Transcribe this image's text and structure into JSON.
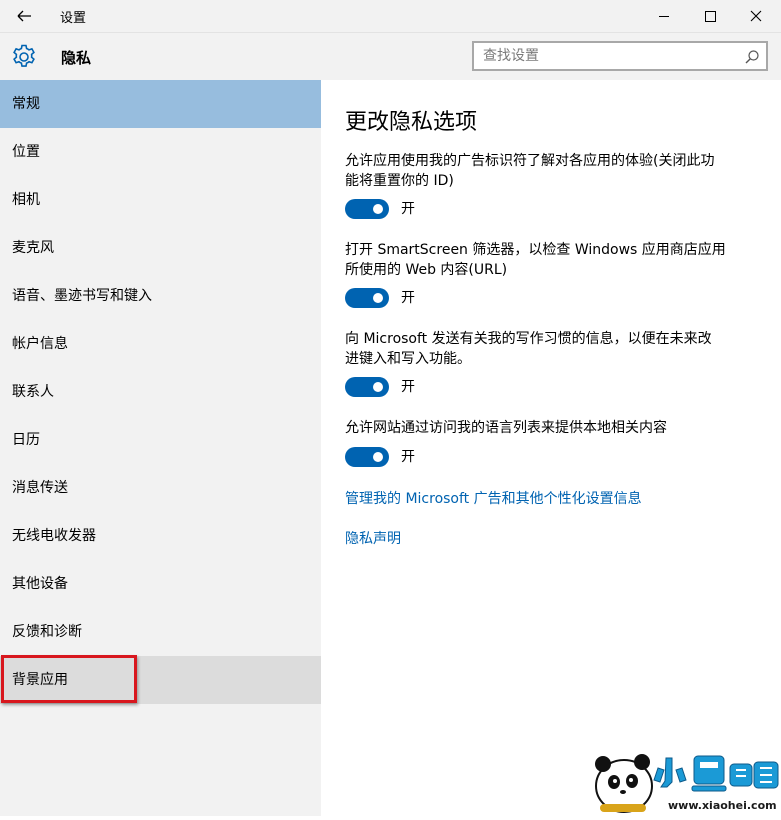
{
  "window": {
    "title": "设置",
    "section_title": "隐私"
  },
  "search": {
    "placeholder": "查找设置",
    "value": ""
  },
  "sidebar": {
    "items": [
      {
        "label": "常规",
        "state": "selected"
      },
      {
        "label": "位置",
        "state": "normal"
      },
      {
        "label": "相机",
        "state": "normal"
      },
      {
        "label": "麦克风",
        "state": "normal"
      },
      {
        "label": "语音、墨迹书写和键入",
        "state": "normal"
      },
      {
        "label": "帐户信息",
        "state": "normal"
      },
      {
        "label": "联系人",
        "state": "normal"
      },
      {
        "label": "日历",
        "state": "normal"
      },
      {
        "label": "消息传送",
        "state": "normal"
      },
      {
        "label": "无线电收发器",
        "state": "normal"
      },
      {
        "label": "其他设备",
        "state": "normal"
      },
      {
        "label": "反馈和诊断",
        "state": "normal"
      },
      {
        "label": "背景应用",
        "state": "hovered"
      }
    ]
  },
  "main": {
    "title": "更改隐私选项",
    "options": [
      {
        "line1": "允许应用使用我的广告标识符了解对各应用的体验(关闭此功",
        "line2": "能将重置你的 ID)",
        "state": "开",
        "on": true
      },
      {
        "line1": "打开 SmartScreen 筛选器，以检查 Windows 应用商店应用",
        "line2": "所使用的 Web 内容(URL)",
        "state": "开",
        "on": true
      },
      {
        "line1": "向 Microsoft 发送有关我的写作习惯的信息，以便在未来改",
        "line2": "进键入和写入功能。",
        "state": "开",
        "on": true
      },
      {
        "line1": "允许网站通过访问我的语言列表来提供本地相关内容",
        "line2": "",
        "state": "开",
        "on": true
      }
    ],
    "links": {
      "manage": "管理我的 Microsoft 广告和其他个性化设置信息",
      "privacy": "隐私声明"
    }
  },
  "watermark": {
    "brand": "小黑游戏",
    "url": "www.xiaohei.com"
  },
  "colors": {
    "accent": "#0063b1",
    "selected": "#97bdde",
    "highlight": "#d8171e"
  },
  "icons": [
    "back-arrow-icon",
    "minimize-icon",
    "maximize-icon",
    "close-icon",
    "gear-icon",
    "search-icon"
  ]
}
